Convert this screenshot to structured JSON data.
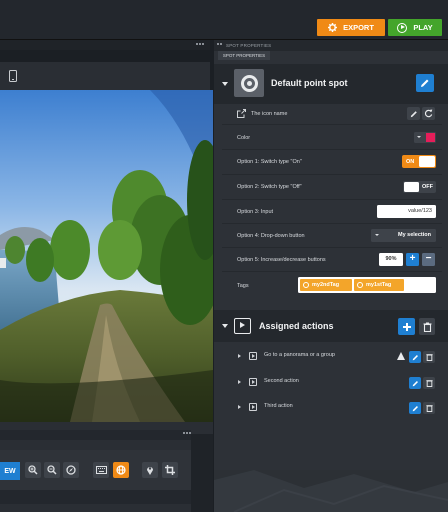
{
  "toolbar": {
    "export_label": "EXPORT",
    "play_label": "PLAY",
    "export_icon": "gear-icon",
    "play_icon": "play-circle-icon"
  },
  "viewport": {
    "device_icon": "mobile-phone-icon",
    "view_button_label": "EW",
    "tools": [
      "zoom-in-icon",
      "zoom-out-icon",
      "compass-icon",
      "keyboard-icon",
      "globe-icon",
      "map-pin-icon",
      "crop-icon"
    ]
  },
  "panel": {
    "tab_label": "SPOT PROPERTIES",
    "subtab_label": "SPOT PROPERTIES",
    "spot_title": "Default point spot",
    "icon_name_label": "The icon name",
    "color_label": "Color",
    "color_value": "#e51e5a",
    "option1_label": "Option 1: Switch type \"On\"",
    "option1_state": "ON",
    "option2_label": "Option 2: Switch type \"Off\"",
    "option2_state": "OFF",
    "option3_label": "Option 3: Input",
    "option3_value": "value/123",
    "option4_label": "Option 4: Drop-down button",
    "option4_value": "My selection",
    "option5_label": "Option 5: Increase/decrease buttons",
    "option5_value": "90%",
    "tags_label": "Tags",
    "tags": [
      "my2ndTag",
      "my1stTag"
    ]
  },
  "actions": {
    "title": "Assigned actions",
    "items": [
      {
        "label": "Go to a panorama or a group",
        "warning": true
      },
      {
        "label": "Second action",
        "warning": false
      },
      {
        "label": "Third action",
        "warning": false
      }
    ]
  },
  "colors": {
    "accent_orange": "#f08a16",
    "accent_green": "#44a52b",
    "accent_blue": "#1f7fd1",
    "panel_bg": "#2d3137",
    "tag_bg": "#f3a52a"
  }
}
